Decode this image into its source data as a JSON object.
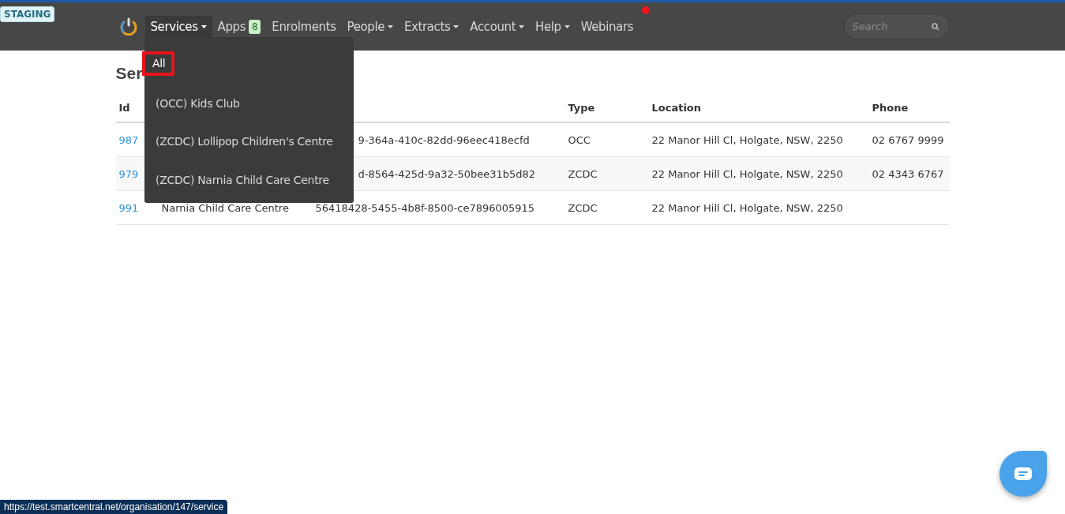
{
  "env_badge": "STAGING",
  "nav": {
    "items": [
      {
        "label": "Services",
        "caret": true,
        "selected": true
      },
      {
        "label": "Apps",
        "badge": "8",
        "caret": false,
        "selected": false
      },
      {
        "label": "Enrolments",
        "caret": false,
        "selected": false
      },
      {
        "label": "People",
        "caret": true,
        "selected": false
      },
      {
        "label": "Extracts",
        "caret": true,
        "selected": false
      },
      {
        "label": "Account",
        "caret": true,
        "selected": false
      },
      {
        "label": "Help",
        "caret": true,
        "selected": false
      },
      {
        "label": "Webinars",
        "caret": false,
        "selected": false,
        "notification": true
      }
    ],
    "search": {
      "placeholder": "Search"
    }
  },
  "dropdown": {
    "items": [
      {
        "label": "All",
        "selected": true
      },
      {
        "label": "(OCC) Kids Club",
        "selected": false
      },
      {
        "label": "(ZCDC) Lollipop Children's Centre",
        "selected": false
      },
      {
        "label": "(ZCDC) Narnia Child Care Centre",
        "selected": false
      }
    ]
  },
  "page_title": "Ser",
  "table": {
    "columns": {
      "id": "Id",
      "type": "Type",
      "location": "Location",
      "phone": "Phone"
    },
    "rows": [
      {
        "id": "987",
        "uid": "9-364a-410c-82dd-96eec418ecfd",
        "type": "OCC",
        "location": "22 Manor Hill Cl, Holgate, NSW, 2250",
        "phone": "02 6767 9999"
      },
      {
        "id": "979",
        "uid": "d-8564-425d-9a32-50bee31b5d82",
        "type": "ZCDC",
        "location": "22 Manor Hill Cl, Holgate, NSW, 2250",
        "phone": "02 4343 6767"
      },
      {
        "id": "991",
        "name": "Narnia Child Care Centre",
        "uid": "56418428-5455-4b8f-8500-ce7896005915",
        "type": "ZCDC",
        "location": "22 Manor Hill Cl, Holgate, NSW, 2250"
      }
    ]
  },
  "status_url": "https://test.smartcentral.net/organisation/147/service"
}
